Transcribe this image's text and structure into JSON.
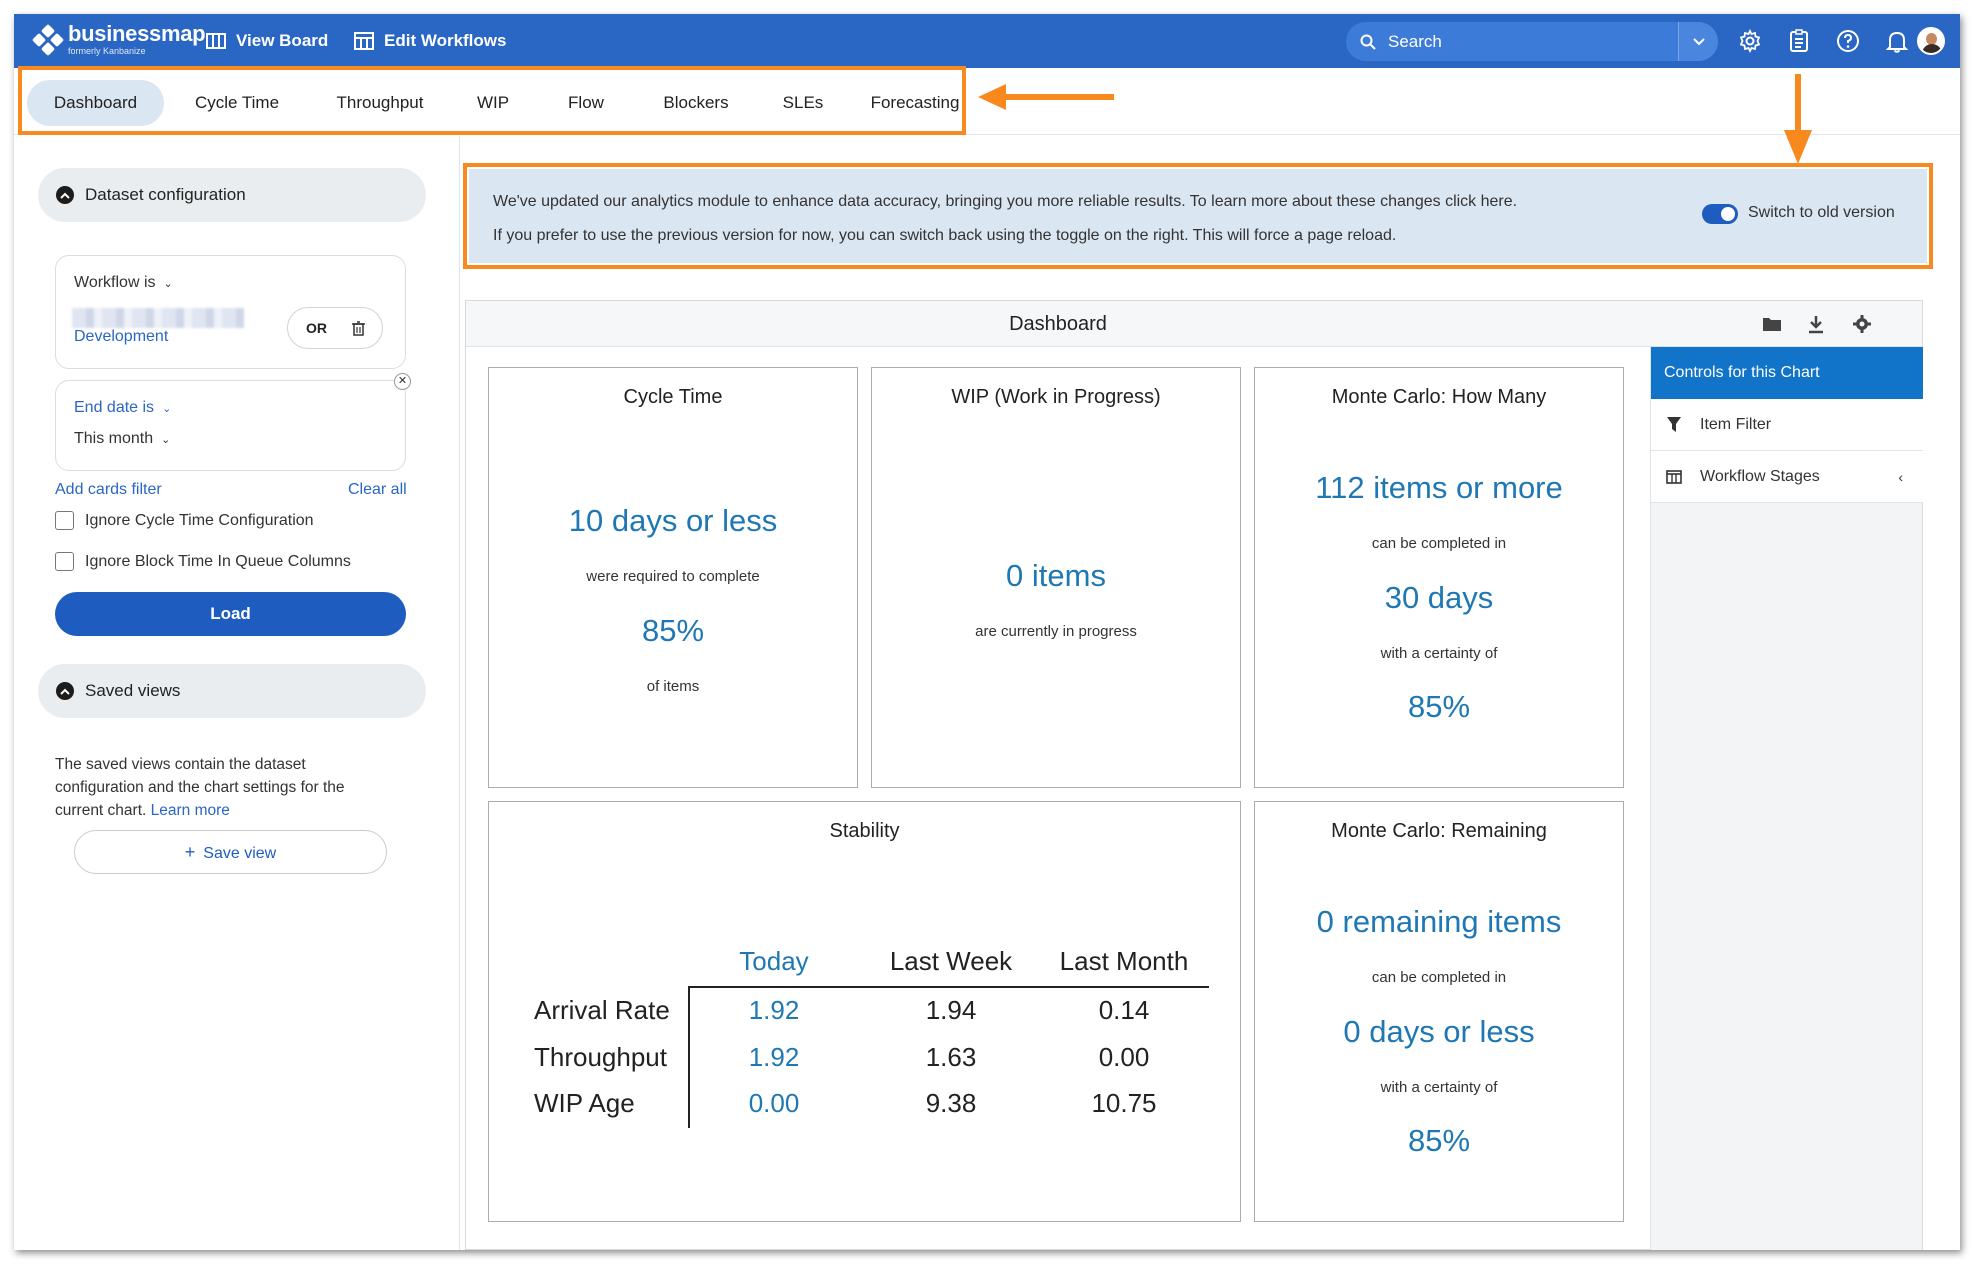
{
  "header": {
    "brand_name": "businessmap",
    "brand_sub": "formerly Kanbanize",
    "nav": [
      {
        "label": "View Board"
      },
      {
        "label": "Edit Workflows"
      }
    ],
    "search_placeholder": "Search"
  },
  "tabs": [
    {
      "label": "Dashboard",
      "active": true
    },
    {
      "label": "Cycle Time",
      "active": false
    },
    {
      "label": "Throughput",
      "active": false
    },
    {
      "label": "WIP",
      "active": false
    },
    {
      "label": "Flow",
      "active": false
    },
    {
      "label": "Blockers",
      "active": false
    },
    {
      "label": "SLEs",
      "active": false
    },
    {
      "label": "Forecasting",
      "active": false
    }
  ],
  "sidebar": {
    "dataset": {
      "title": "Dataset configuration",
      "workflow_label": "Workflow is",
      "workflow_value": "Development",
      "or_label": "OR",
      "end_date_label": "End date is",
      "end_date_value": "This month",
      "add_filter": "Add cards filter",
      "clear_all": "Clear all",
      "ignore_cycle": "Ignore Cycle Time Configuration",
      "ignore_block": "Ignore Block Time In Queue Columns",
      "load": "Load"
    },
    "saved": {
      "title": "Saved views",
      "description": "The saved views contain the dataset configuration and the chart settings for the current chart.",
      "learn_more": "Learn more",
      "save_view": "Save view"
    }
  },
  "banner": {
    "line1": "We've updated our analytics module to enhance data accuracy, bringing you more reliable results. To learn more about these changes click here.",
    "line2": "If you prefer to use the previous version for now, you can switch back using the toggle on the right. This will force a page reload.",
    "toggle_label": "Switch to old version",
    "toggle_on": true
  },
  "dashboard": {
    "title": "Dashboard",
    "controls": {
      "title": "Controls for this Chart",
      "items": [
        {
          "label": "Item Filter"
        },
        {
          "label": "Workflow Stages"
        }
      ]
    },
    "cycle_time": {
      "title": "Cycle Time",
      "value": "10 days or less",
      "text1": "were required to complete",
      "percent": "85%",
      "text2": "of items"
    },
    "wip": {
      "title": "WIP (Work in Progress)",
      "value": "0 items",
      "text": "are currently in progress"
    },
    "mc_how_many": {
      "title": "Monte Carlo: How Many",
      "value": "112 items or more",
      "text1": "can be completed in",
      "days": "30 days",
      "text2": "with a certainty of",
      "percent": "85%"
    },
    "stability": {
      "title": "Stability",
      "columns": [
        "Today",
        "Last Week",
        "Last Month"
      ],
      "rows": [
        {
          "label": "Arrival Rate",
          "values": [
            "1.92",
            "1.94",
            "0.14"
          ]
        },
        {
          "label": "Throughput",
          "values": [
            "1.92",
            "1.63",
            "0.00"
          ]
        },
        {
          "label": "WIP Age",
          "values": [
            "0.00",
            "9.38",
            "10.75"
          ]
        }
      ]
    },
    "mc_remaining": {
      "title": "Monte Carlo: Remaining",
      "value": "0 remaining items",
      "text1": "can be completed in",
      "days": "0 days or less",
      "text2": "with a certainty of",
      "percent": "85%"
    }
  },
  "colors": {
    "header_bg": "#2a66c4",
    "highlight": "#f7891f",
    "accent_value": "#1f78b4",
    "button_primary": "#1e5cc0"
  }
}
